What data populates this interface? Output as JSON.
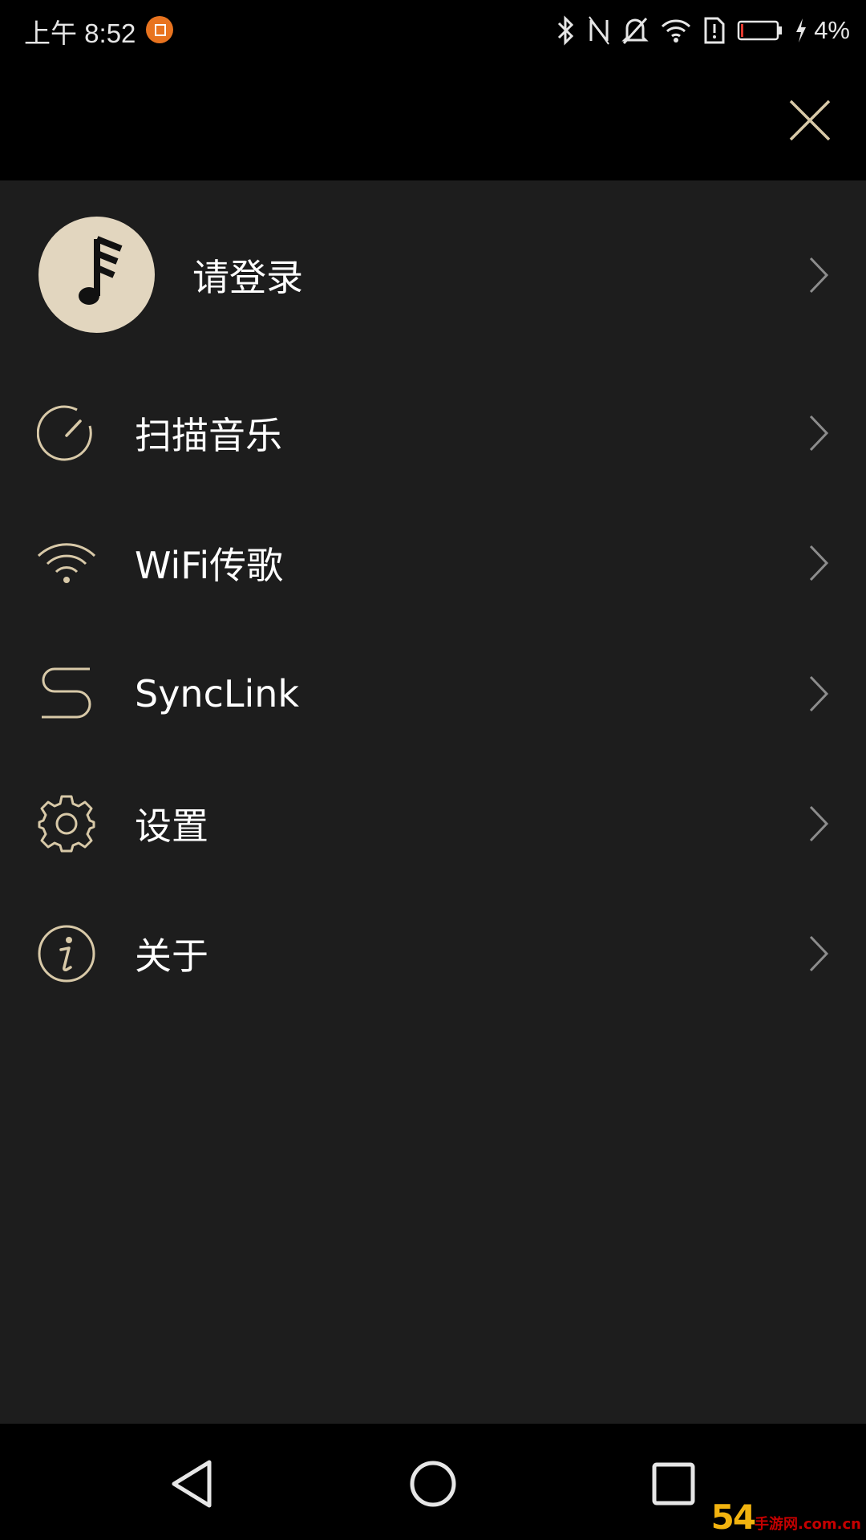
{
  "status_bar": {
    "time": "上午 8:52",
    "battery_percent": "4%",
    "icons": [
      "notification-app-icon",
      "bluetooth-icon",
      "nfc-icon",
      "mute-icon",
      "wifi-icon",
      "sim-alert-icon",
      "battery-icon",
      "charging-icon"
    ]
  },
  "header": {
    "close_icon": "close-icon"
  },
  "user": {
    "login_label": "请登录",
    "avatar_icon": "music-note-icon"
  },
  "menu": [
    {
      "id": "scan",
      "label": "扫描音乐",
      "icon": "scan-gauge-icon"
    },
    {
      "id": "wifi",
      "label": "WiFi传歌",
      "icon": "wifi-icon"
    },
    {
      "id": "synclink",
      "label": "SyncLink",
      "icon": "synclink-icon"
    },
    {
      "id": "settings",
      "label": "设置",
      "icon": "gear-icon"
    },
    {
      "id": "about",
      "label": "关于",
      "icon": "info-icon"
    }
  ],
  "nav": {
    "back": "back-icon",
    "home": "home-icon",
    "recents": "recents-icon"
  },
  "watermark": {
    "main": "54",
    "suffix": "手游网",
    "domain": ".com.cn"
  },
  "colors": {
    "accent": "#d8c9a8",
    "panel": "#1d1d1d",
    "avatar_bg": "#e2d6bf",
    "chevron": "#8c8c8c"
  }
}
